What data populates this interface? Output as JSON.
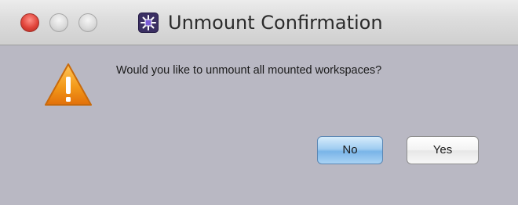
{
  "window": {
    "title": "Unmount Confirmation"
  },
  "icons": {
    "app": "app-icon",
    "alert": "warning-icon"
  },
  "dialog": {
    "message": "Would you like to unmount all mounted workspaces?",
    "buttons": {
      "no_label": "No",
      "yes_label": "Yes"
    }
  },
  "colors": {
    "background": "#b9b8c3",
    "close_button": "#e0443a",
    "default_button": "#7ab5e8",
    "warning": "#f29d1c"
  }
}
